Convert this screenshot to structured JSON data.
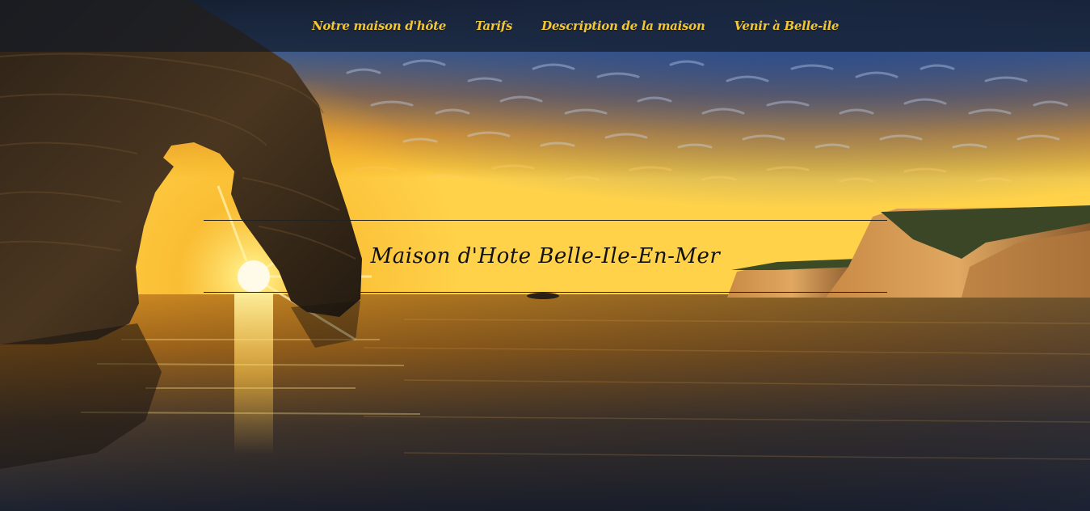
{
  "nav": {
    "items": [
      {
        "label": "Notre maison d'hôte"
      },
      {
        "label": "Tarifs"
      },
      {
        "label": "Description de la maison"
      },
      {
        "label": "Venir à Belle-ile"
      }
    ]
  },
  "hero": {
    "title": "Maison d'Hote Belle-Ile-En-Mer"
  },
  "colors": {
    "nav_text": "#f3c632",
    "nav_bg": "#141a26",
    "title_text": "#111111"
  }
}
